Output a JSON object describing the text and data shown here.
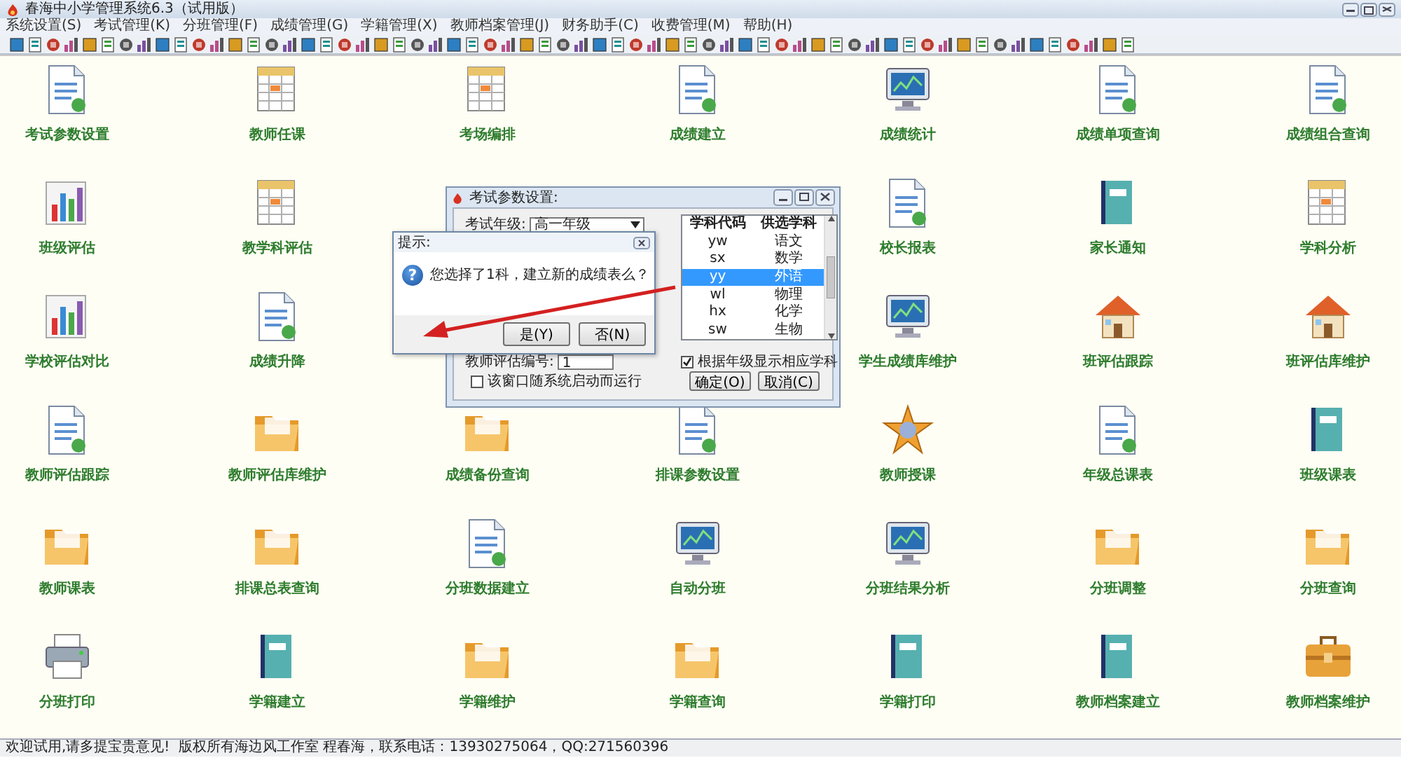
{
  "window": {
    "title": "春海中小学管理系统6.3（试用版）"
  },
  "menu": [
    "系统设置(S)",
    "考试管理(K)",
    "分班管理(F)",
    "成绩管理(G)",
    "学籍管理(X)",
    "教师档案管理(J)",
    "财务助手(C)",
    "收费管理(M)",
    "帮助(H)"
  ],
  "launcher": [
    [
      {
        "label": "考试参数设置"
      },
      {
        "label": "教师任课"
      },
      {
        "label": "考场编排"
      },
      {
        "label": "成绩建立"
      },
      {
        "label": "成绩统计"
      },
      {
        "label": "成绩单项查询"
      },
      {
        "label": "成绩组合查询"
      }
    ],
    [
      {
        "label": "班级评估"
      },
      {
        "label": "教学科评估"
      },
      {
        "label": "校长报表"
      },
      {
        "label": "家长通知"
      },
      {
        "label": "学科分析"
      }
    ],
    [
      {
        "label": "学校评估对比"
      },
      {
        "label": "成绩升降"
      },
      {
        "label": "学生成绩库维护"
      },
      {
        "label": "班评估跟踪"
      },
      {
        "label": "班评估库维护"
      }
    ],
    [
      {
        "label": "教师评估跟踪"
      },
      {
        "label": "教师评估库维护"
      },
      {
        "label": "成绩备份查询"
      },
      {
        "label": "排课参数设置"
      },
      {
        "label": "教师授课"
      },
      {
        "label": "年级总课表"
      },
      {
        "label": "班级课表"
      }
    ],
    [
      {
        "label": "教师课表"
      },
      {
        "label": "排课总表查询"
      },
      {
        "label": "分班数据建立"
      },
      {
        "label": "自动分班"
      },
      {
        "label": "分班结果分析"
      },
      {
        "label": "分班调整"
      },
      {
        "label": "分班查询"
      }
    ],
    [
      {
        "label": "分班打印"
      },
      {
        "label": "学籍建立"
      },
      {
        "label": "学籍维护"
      },
      {
        "label": "学籍查询"
      },
      {
        "label": "学籍打印"
      },
      {
        "label": "教师档案建立"
      },
      {
        "label": "教师档案维护"
      }
    ]
  ],
  "param_dialog": {
    "title": "考试参数设置:",
    "grade_label": "考试年级:",
    "grade_value": "高一年级",
    "columns": [
      "学科代码",
      "供选学科"
    ],
    "subjects": [
      {
        "code": "yw",
        "name": "语文",
        "selected": false
      },
      {
        "code": "sx",
        "name": "数学",
        "selected": false
      },
      {
        "code": "yy",
        "name": "外语",
        "selected": true
      },
      {
        "code": "wl",
        "name": "物理",
        "selected": false
      },
      {
        "code": "hx",
        "name": "化学",
        "selected": false
      },
      {
        "code": "sw",
        "name": "生物",
        "selected": false
      }
    ],
    "eval_label": "教师评估编号:",
    "eval_value": "1",
    "filter_check": {
      "label": "根据年级显示相应学科",
      "checked": true
    },
    "autostart_check": {
      "label": "该窗口随系统启动而运行",
      "checked": false
    },
    "buttons": [
      "确定(O)",
      "取消(C)"
    ]
  },
  "message_box": {
    "title": "提示:",
    "icon_glyph": "?",
    "message": "您选择了1科，建立新的成绩表么？",
    "buttons": [
      "是(Y)",
      "否(N)"
    ]
  },
  "status_bar": "欢迎试用,请多提宝贵意见!  版权所有海边风工作室 程春海，联系电话：13930275064，QQ:271560396"
}
